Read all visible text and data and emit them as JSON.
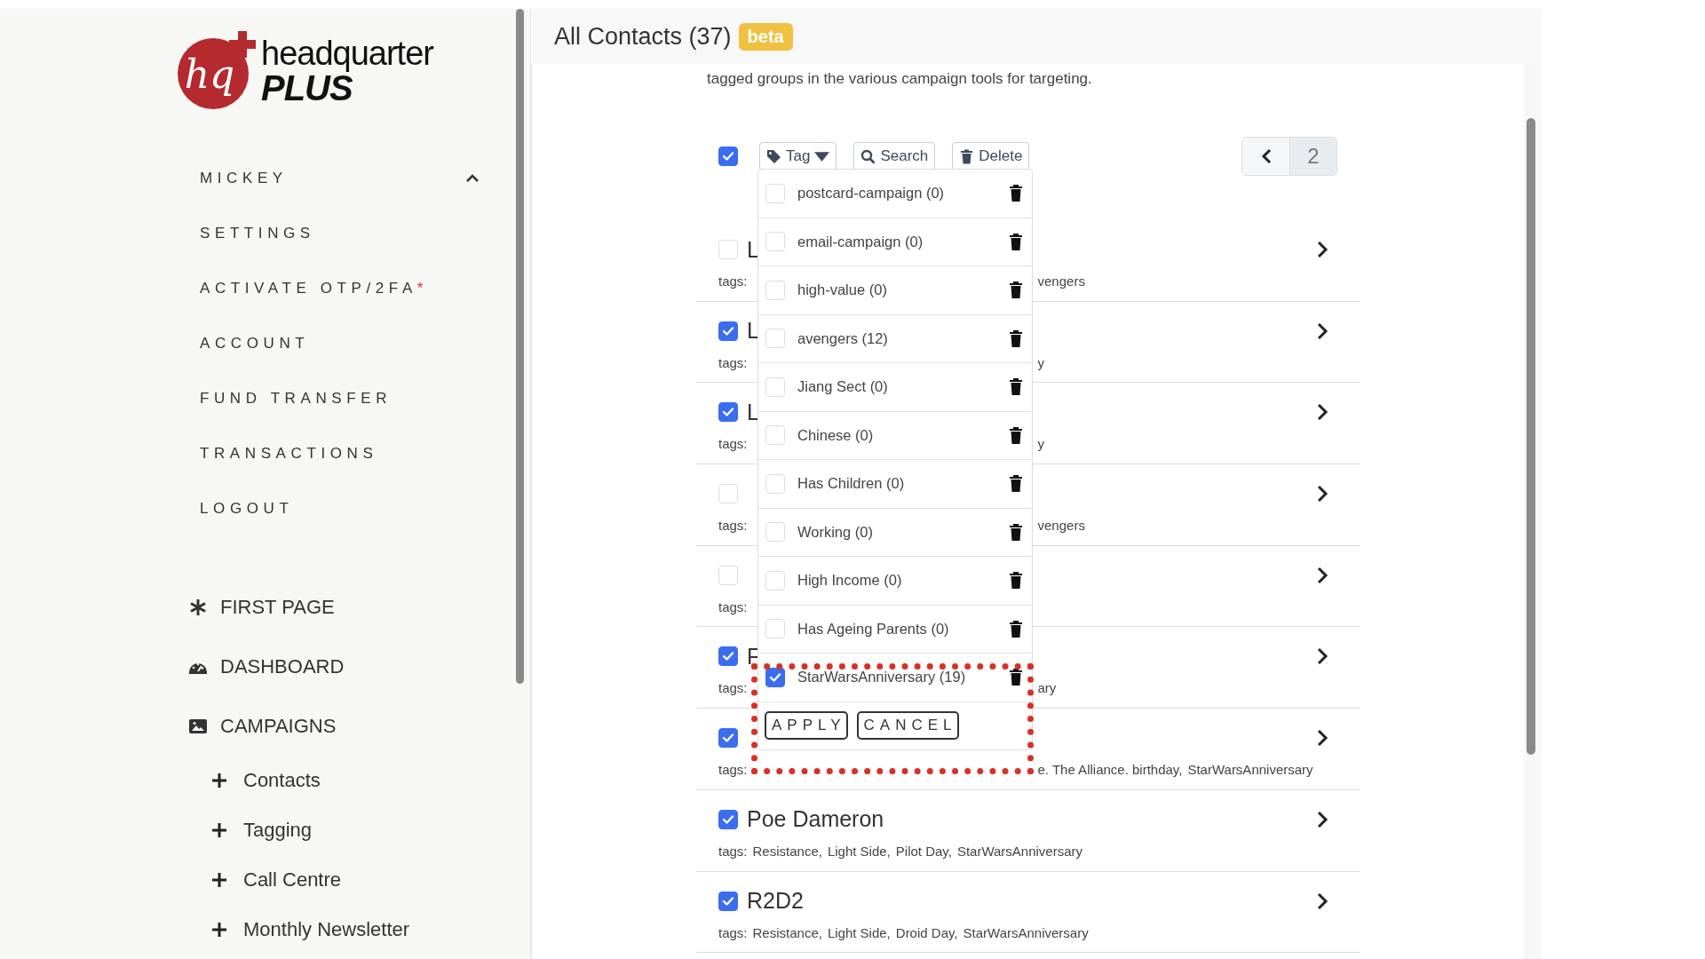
{
  "logo": {
    "mark": "hq",
    "name": "headquarter",
    "sub": "PLUS"
  },
  "sidebar": {
    "account": {
      "label": "MICKEY",
      "expanded": true
    },
    "menu": [
      {
        "label": "SETTINGS"
      },
      {
        "label": "ACTIVATE OTP/2FA",
        "marker": "*"
      },
      {
        "label": "ACCOUNT"
      },
      {
        "label": "FUND TRANSFER"
      },
      {
        "label": "TRANSACTIONS"
      },
      {
        "label": "LOGOUT"
      }
    ],
    "nav": [
      {
        "kind": "asterisk",
        "label": "FIRST PAGE"
      },
      {
        "kind": "dashboard",
        "label": "DASHBOARD"
      },
      {
        "kind": "image",
        "label": "CAMPAIGNS"
      }
    ],
    "sub_items": [
      {
        "label": "Contacts"
      },
      {
        "label": "Tagging"
      },
      {
        "label": "Call Centre"
      },
      {
        "label": "Monthly Newsletter"
      }
    ]
  },
  "header": {
    "title": "All Contacts (37)",
    "badge": "beta"
  },
  "description": "tagged groups in the various campaign tools for targeting.",
  "toolbar": {
    "select_all": {
      "checked": true
    },
    "buttons": [
      {
        "kind": "tag",
        "label": "Tag"
      },
      {
        "kind": "search",
        "label": "Search"
      },
      {
        "kind": "delete",
        "label": "Delete"
      }
    ],
    "pager": {
      "page": "2"
    }
  },
  "contacts": [
    {
      "kind": "covered",
      "name": "L",
      "checked": false,
      "tags_label": "tags:",
      "tags": [
        "vengers"
      ]
    },
    {
      "kind": "covered",
      "name": "L",
      "checked": true,
      "tags_label": "tags:",
      "tags": [
        "y"
      ]
    },
    {
      "kind": "covered",
      "name": "L",
      "checked": true,
      "tags_label": "tags:",
      "tags": [
        "y"
      ]
    },
    {
      "kind": "covered",
      "checked": false,
      "tags_label": "tags:",
      "tags": [
        "vengers"
      ]
    },
    {
      "kind": "covered",
      "checked": false,
      "tags_label": "tags:"
    },
    {
      "kind": "covered",
      "name": "F",
      "checked": true,
      "tags_label": "tags:",
      "tags": [
        "ary"
      ]
    },
    {
      "kind": "covered",
      "checked": true,
      "tags_label": "tags:",
      "tags": [
        "e. The Alliance. birthday,",
        "StarWarsAnniversary"
      ]
    },
    {
      "kind": "full",
      "name": "Poe Dameron",
      "checked": true,
      "tags_label": "tags:",
      "tags": [
        "Resistance,",
        "Light Side,",
        "Pilot Day,",
        "StarWarsAnniversary"
      ]
    },
    {
      "kind": "full",
      "name": "R2D2",
      "checked": true,
      "tags_label": "tags:",
      "tags": [
        "Resistance,",
        "Light Side,",
        "Droid Day,",
        "StarWarsAnniversary"
      ]
    }
  ],
  "tag_menu": {
    "items": [
      {
        "label": "postcard-campaign (0)",
        "checked": false
      },
      {
        "label": "email-campaign (0)",
        "checked": false
      },
      {
        "label": "high-value (0)",
        "checked": false
      },
      {
        "label": "avengers (12)",
        "checked": false
      },
      {
        "label": "Jiang Sect (0)",
        "checked": false
      },
      {
        "label": "Chinese (0)",
        "checked": false
      },
      {
        "label": "Has Children (0)",
        "checked": false
      },
      {
        "label": "Working (0)",
        "checked": false
      },
      {
        "label": "High Income (0)",
        "checked": false
      },
      {
        "label": "Has Ageing Parents (0)",
        "checked": false
      },
      {
        "label": "StarWarsAnniversary (19)",
        "checked": true
      }
    ],
    "actions": [
      "APPLY",
      "CANCEL"
    ]
  }
}
